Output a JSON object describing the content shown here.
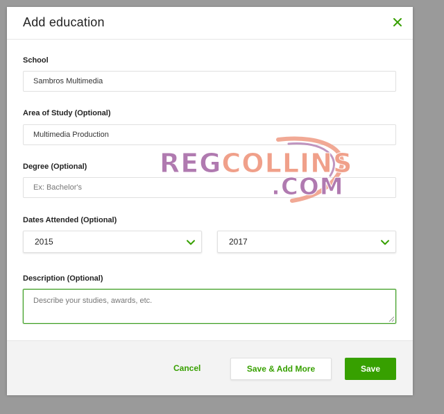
{
  "modal": {
    "title": "Add education"
  },
  "fields": {
    "school": {
      "label": "School",
      "value": "Sambros Multimedia"
    },
    "area_of_study": {
      "label": "Area of Study (Optional)",
      "value": "Multimedia Production"
    },
    "degree": {
      "label": "Degree (Optional)",
      "placeholder": "Ex: Bachelor's"
    },
    "dates": {
      "label": "Dates Attended (Optional)",
      "from": "2015",
      "to": "2017"
    },
    "description": {
      "label": "Description (Optional)",
      "placeholder": "Describe your studies, awards, etc."
    }
  },
  "footer": {
    "cancel_label": "Cancel",
    "save_add_more_label": "Save & Add More",
    "save_label": "Save"
  },
  "watermark": {
    "part1": "REG",
    "part2": "COLLINS",
    "part3": ".COM"
  },
  "colors": {
    "accent": "#37a000",
    "watermark_purple": "#b07ab0",
    "watermark_orange": "#f0a08a"
  },
  "icons": {
    "close": "close-icon",
    "chevron": "chevron-down-icon"
  }
}
